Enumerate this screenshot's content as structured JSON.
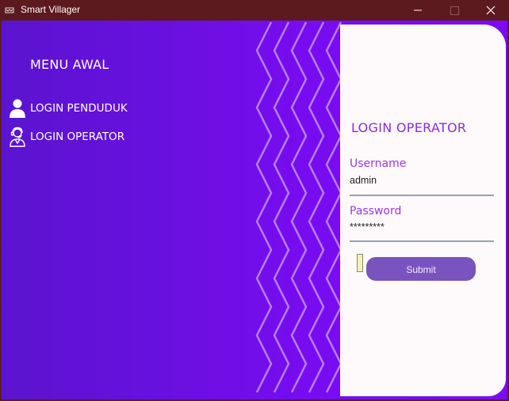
{
  "window": {
    "title": "Smart Villager",
    "app_icon": "app-icon",
    "controls": [
      "minimize-icon",
      "maximize-icon",
      "close-icon"
    ]
  },
  "sidebar": {
    "title": "MENU AWAL",
    "items": [
      {
        "label": "LOGIN PENDUDUK",
        "icon": "person-icon"
      },
      {
        "label": "LOGIN OPERATOR",
        "icon": "operator-headset-icon"
      }
    ]
  },
  "login": {
    "title": "LOGIN OPERATOR",
    "username_label": "Username",
    "username_value": "admin",
    "password_label": "Password",
    "password_value": "*********",
    "submit_label": "Submit"
  },
  "colors": {
    "titlebar": "#5c1a1f",
    "gradient_start": "#5a14cf",
    "gradient_end": "#7d0af5",
    "accent_text": "#8a2be2",
    "button": "#7a54be",
    "panel": "#fefafb"
  }
}
